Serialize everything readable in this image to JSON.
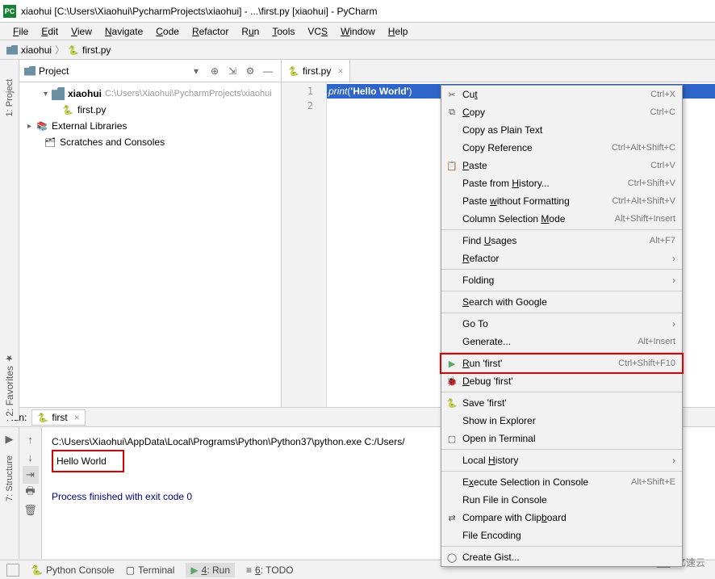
{
  "title": "xiaohui [C:\\Users\\Xiaohui\\PycharmProjects\\xiaohui] - ...\\first.py [xiaohui] - PyCharm",
  "menubar": [
    "File",
    "Edit",
    "View",
    "Navigate",
    "Code",
    "Refactor",
    "Run",
    "Tools",
    "VCS",
    "Window",
    "Help"
  ],
  "breadcrumb": {
    "folder": "xiaohui",
    "file": "first.py"
  },
  "sidebar": {
    "project": "1: Project",
    "favorites": "2: Favorites",
    "structure": "7: Structure"
  },
  "project_panel": {
    "title": "Project",
    "root": {
      "name": "xiaohui",
      "path": "C:\\Users\\Xiaohui\\PycharmProjects\\xiaohui"
    },
    "file": "first.py",
    "ext_libs": "External Libraries",
    "scratches": "Scratches and Consoles"
  },
  "editor": {
    "tab": "first.py",
    "line1_fn": "print",
    "line1_paren_l": "(",
    "line1_str": "'Hello World'",
    "line1_paren_r": ")"
  },
  "context_menu": [
    {
      "icon": "cut",
      "label": "Cut",
      "u": 2,
      "shortcut": "Ctrl+X"
    },
    {
      "icon": "copy",
      "label": "Copy",
      "u": 0,
      "shortcut": "Ctrl+C"
    },
    {
      "icon": "",
      "label": "Copy as Plain Text",
      "u": -1,
      "shortcut": ""
    },
    {
      "icon": "",
      "label": "Copy Reference",
      "u": -1,
      "shortcut": "Ctrl+Alt+Shift+C"
    },
    {
      "icon": "paste",
      "label": "Paste",
      "u": 0,
      "shortcut": "Ctrl+V"
    },
    {
      "icon": "",
      "label": "Paste from History...",
      "u": 11,
      "shortcut": "Ctrl+Shift+V"
    },
    {
      "icon": "",
      "label": "Paste without Formatting",
      "u": 6,
      "shortcut": "Ctrl+Alt+Shift+V"
    },
    {
      "icon": "",
      "label": "Column Selection Mode",
      "u": 17,
      "shortcut": "Alt+Shift+Insert"
    },
    {
      "sep": true
    },
    {
      "icon": "",
      "label": "Find Usages",
      "u": 5,
      "shortcut": "Alt+F7"
    },
    {
      "icon": "",
      "label": "Refactor",
      "u": 0,
      "submenu": true
    },
    {
      "sep": true
    },
    {
      "icon": "",
      "label": "Folding",
      "u": -1,
      "submenu": true
    },
    {
      "sep": true
    },
    {
      "icon": "",
      "label": "Search with Google",
      "u": 0,
      "shortcut": ""
    },
    {
      "sep": true
    },
    {
      "icon": "",
      "label": "Go To",
      "u": -1,
      "submenu": true
    },
    {
      "icon": "",
      "label": "Generate...",
      "u": -1,
      "shortcut": "Alt+Insert"
    },
    {
      "sep": true
    },
    {
      "icon": "play",
      "label": "Run 'first'",
      "u": 0,
      "shortcut": "Ctrl+Shift+F10",
      "highlight": true
    },
    {
      "icon": "bug",
      "label": "Debug 'first'",
      "u": 0,
      "shortcut": ""
    },
    {
      "sep": true
    },
    {
      "icon": "py",
      "label": "Save 'first'",
      "u": -1,
      "shortcut": ""
    },
    {
      "icon": "",
      "label": "Show in Explorer",
      "u": -1,
      "shortcut": ""
    },
    {
      "icon": "term",
      "label": "Open in Terminal",
      "u": -1,
      "shortcut": ""
    },
    {
      "sep": true
    },
    {
      "icon": "",
      "label": "Local History",
      "u": 6,
      "submenu": true
    },
    {
      "sep": true
    },
    {
      "icon": "",
      "label": "Execute Selection in Console",
      "u": 1,
      "shortcut": "Alt+Shift+E"
    },
    {
      "icon": "",
      "label": "Run File in Console",
      "u": -1,
      "shortcut": ""
    },
    {
      "icon": "diff",
      "label": "Compare with Clipboard",
      "u": 17,
      "shortcut": ""
    },
    {
      "icon": "",
      "label": "File Encoding",
      "u": -1,
      "shortcut": ""
    },
    {
      "sep": true
    },
    {
      "icon": "gh",
      "label": "Create Gist...",
      "u": -1,
      "shortcut": ""
    }
  ],
  "run": {
    "label": "Run:",
    "tab": "first",
    "cmd": "C:\\Users\\Xiaohui\\AppData\\Local\\Programs\\Python\\Python37\\python.exe C:/Users/",
    "output": "Hello World",
    "exit": "Process finished with exit code 0"
  },
  "statusbar": {
    "python_console": "Python Console",
    "terminal": "Terminal",
    "run": "4: Run",
    "todo": "6: TODO"
  },
  "watermark": "亿速云"
}
